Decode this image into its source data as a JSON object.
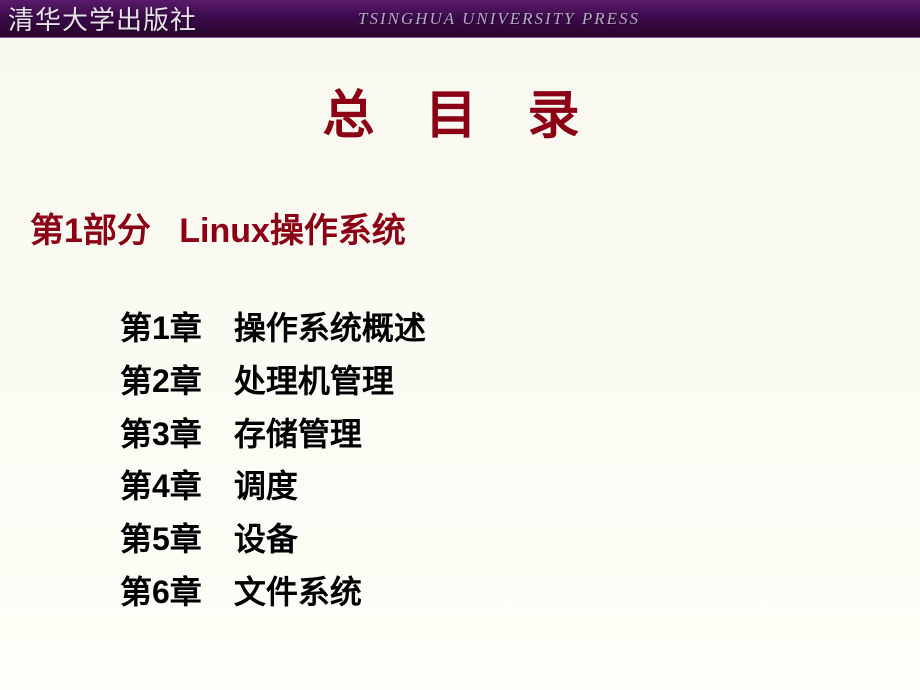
{
  "header": {
    "publisher_cn": "清华大学出版社",
    "publisher_en": "TSINGHUA UNIVERSITY PRESS"
  },
  "title": "总 目 录",
  "section": {
    "part_label": "第1部分",
    "part_title": "Linux操作系统"
  },
  "chapters": [
    {
      "label": "第1章",
      "title": "操作系统概述"
    },
    {
      "label": "第2章",
      "title": "处理机管理"
    },
    {
      "label": "第3章",
      "title": "存储管理"
    },
    {
      "label": "第4章",
      "title": "调度"
    },
    {
      "label": "第5章",
      "title": "设备"
    },
    {
      "label": "第6章",
      "title": "文件系统"
    }
  ]
}
